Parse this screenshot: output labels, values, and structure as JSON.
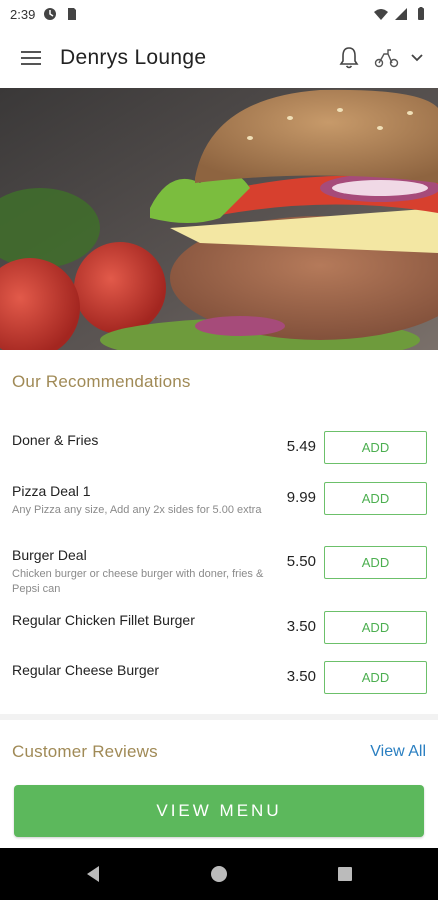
{
  "status_bar": {
    "time": "2:39",
    "icons": [
      "data-saver-icon",
      "sim-icon",
      "wifi-icon",
      "signal-icon",
      "battery-icon"
    ]
  },
  "app_bar": {
    "title": "Denrys Lounge",
    "icons": [
      "hamburger-menu-icon",
      "bell-icon",
      "scooter-icon",
      "chevron-down-icon"
    ]
  },
  "hero": {
    "image": "burger-photo"
  },
  "recommendations": {
    "title": "Our Recommendations",
    "items": [
      {
        "name": "Doner & Fries",
        "description": "",
        "price": "5.49",
        "button": "ADD"
      },
      {
        "name": "Pizza Deal 1",
        "description": "Any Pizza any size, Add any 2x sides for 5.00 extra",
        "price": "9.99",
        "button": "ADD"
      },
      {
        "name": "Burger Deal",
        "description": "Chicken burger or cheese burger with doner, fries & Pepsi can",
        "price": "5.50",
        "button": "ADD"
      },
      {
        "name": "Regular Chicken Fillet Burger",
        "description": "",
        "price": "3.50",
        "button": "ADD"
      },
      {
        "name": "Regular Cheese Burger",
        "description": "",
        "price": "3.50",
        "button": "ADD"
      }
    ]
  },
  "reviews": {
    "title": "Customer Reviews",
    "view_all": "View All"
  },
  "cta": {
    "label": "VIEW MENU"
  },
  "colors": {
    "accent_gold": "#a08a56",
    "green": "#5cb85c",
    "link_blue": "#2a7fc1"
  }
}
